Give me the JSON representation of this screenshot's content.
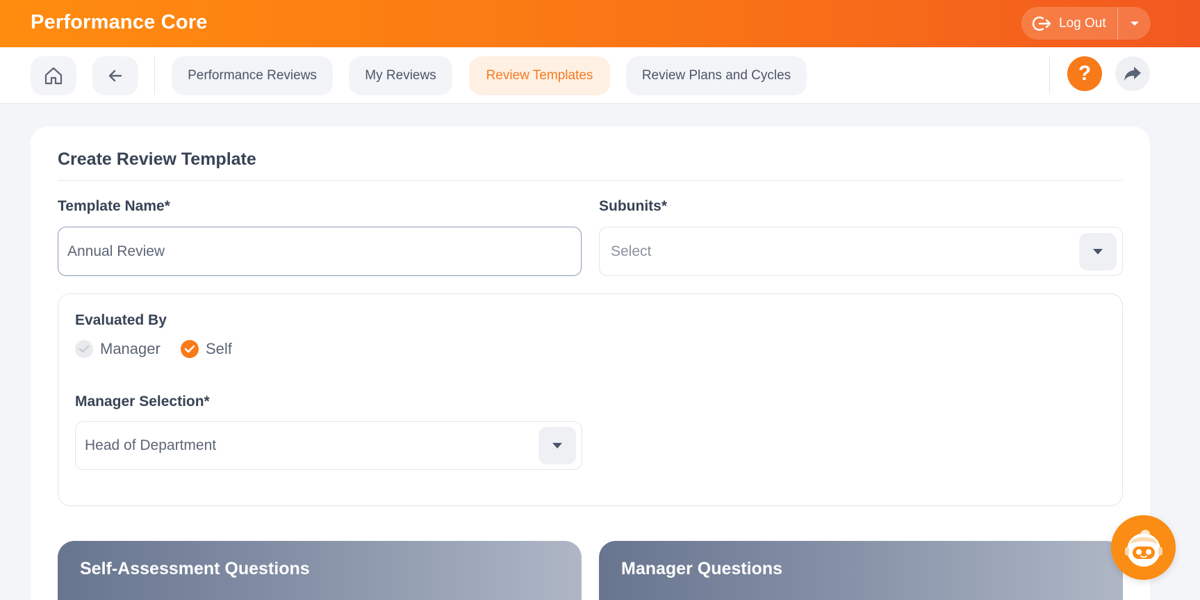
{
  "app": {
    "title": "Performance Core"
  },
  "header": {
    "logout_label": "Log Out"
  },
  "nav": {
    "tabs": [
      {
        "label": "Performance Reviews",
        "active": false
      },
      {
        "label": "My Reviews",
        "active": false
      },
      {
        "label": "Review Templates",
        "active": true
      },
      {
        "label": "Review Plans and Cycles",
        "active": false
      }
    ],
    "help_label": "?"
  },
  "form": {
    "title": "Create Review Template",
    "template_name": {
      "label": "Template Name*",
      "value": "Annual Review"
    },
    "subunits": {
      "label": "Subunits*",
      "placeholder": "Select"
    },
    "evaluated_by": {
      "label": "Evaluated By",
      "options": [
        {
          "label": "Manager",
          "checked": true,
          "disabled": true
        },
        {
          "label": "Self",
          "checked": true,
          "disabled": false
        }
      ]
    },
    "manager_selection": {
      "label": "Manager Selection*",
      "value": "Head of Department"
    }
  },
  "sections": {
    "self_assessment": "Self-Assessment Questions",
    "manager": "Manager Questions"
  },
  "colors": {
    "accent": "#f97a18",
    "header_start": "#ff8c0f",
    "header_end": "#f2581f",
    "active_tab_bg": "#fff0e4"
  }
}
